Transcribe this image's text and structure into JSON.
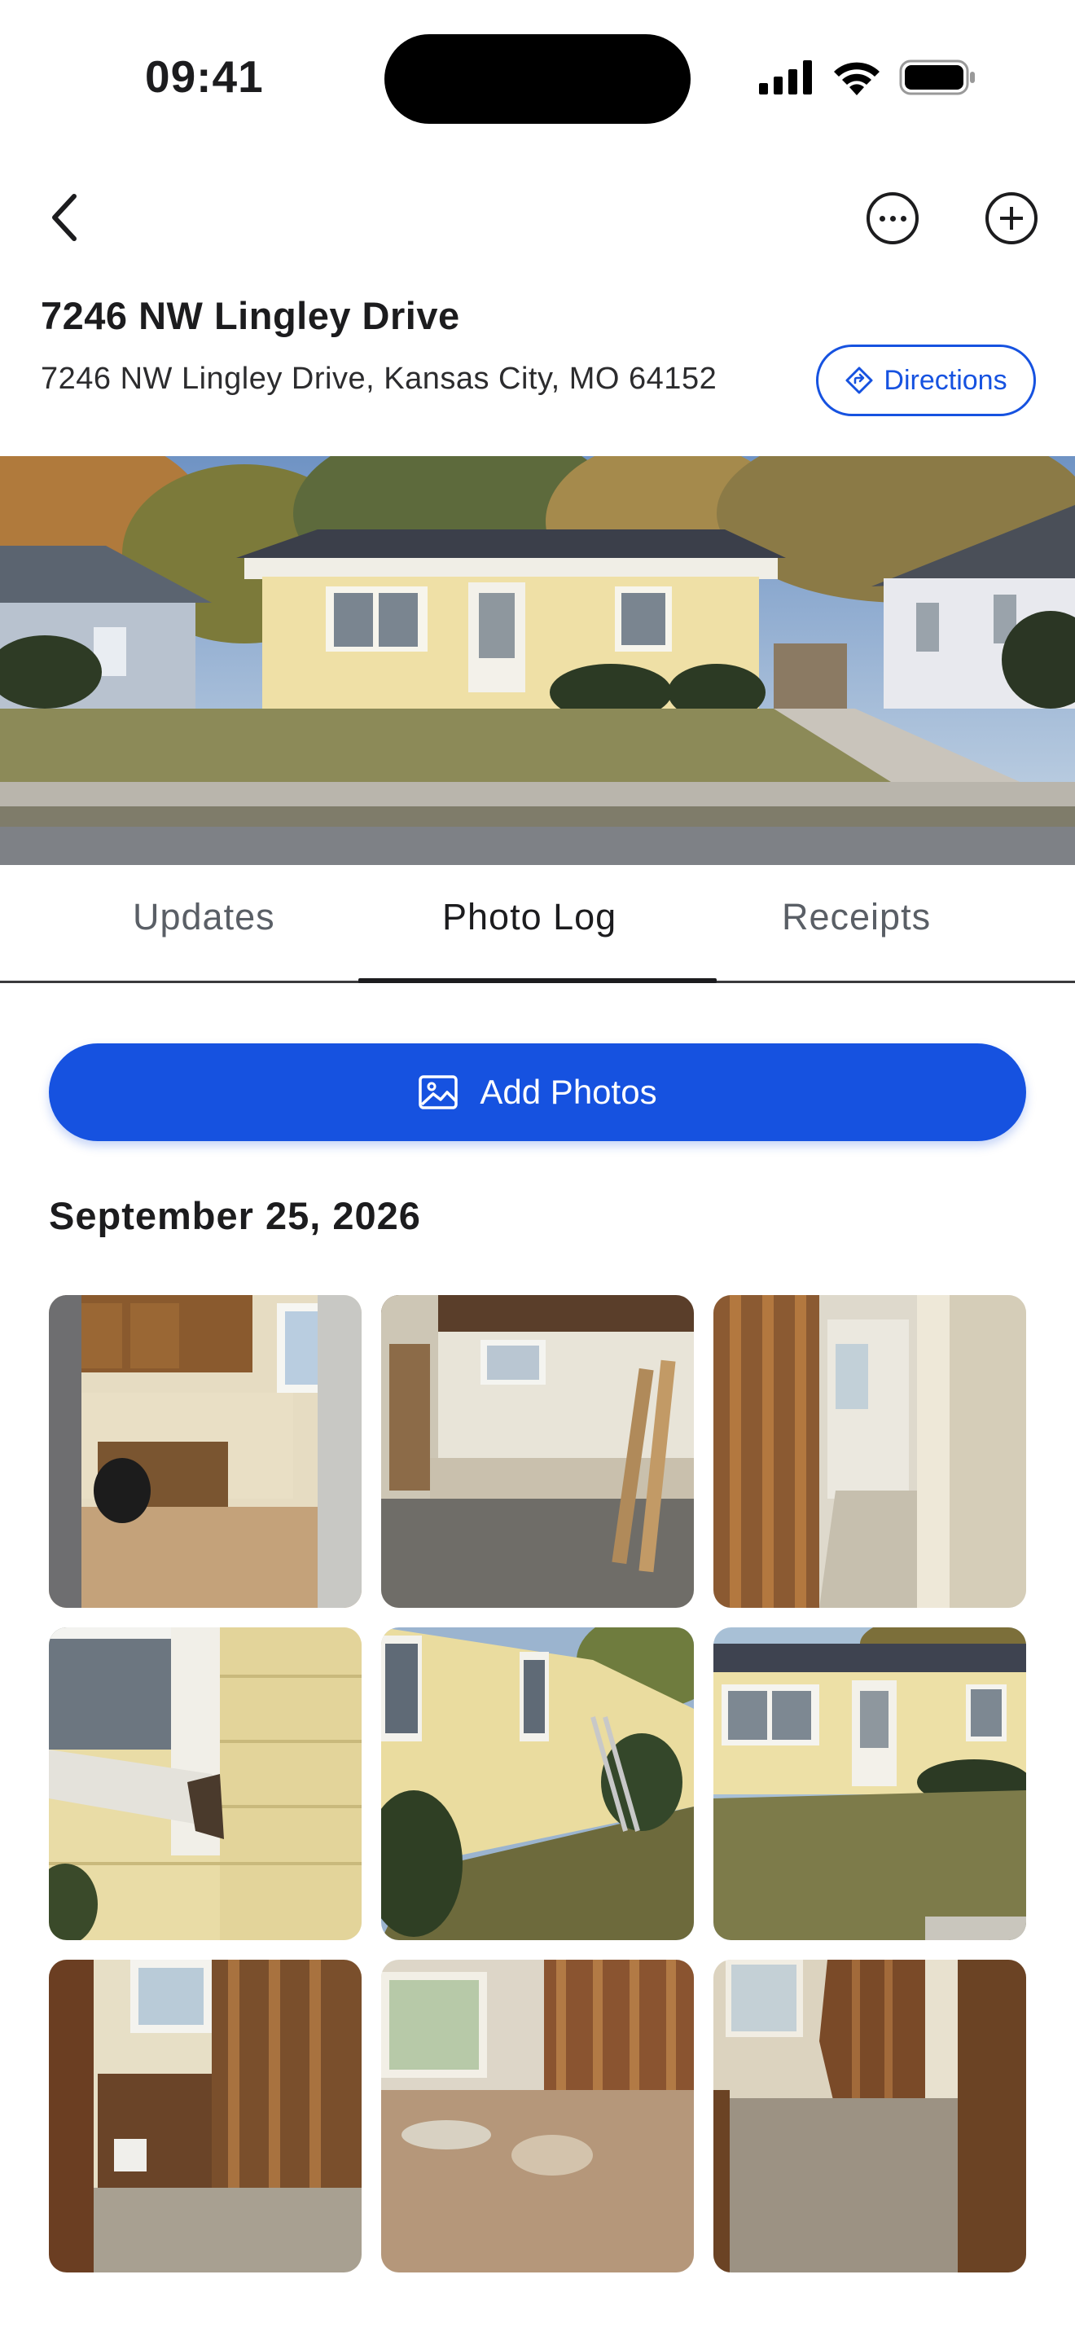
{
  "status_bar": {
    "time": "09:41"
  },
  "nav": {
    "back_icon": "chevron-left-icon",
    "more_icon": "ellipsis-circle-icon",
    "add_icon": "plus-circle-icon"
  },
  "property": {
    "title": "7246 NW Lingley Drive",
    "address": "7246 NW Lingley Drive, Kansas City, MO 64152",
    "directions_label": "Directions"
  },
  "tabs": [
    {
      "label": "Updates",
      "active": false
    },
    {
      "label": "Photo Log",
      "active": true
    },
    {
      "label": "Receipts",
      "active": false
    }
  ],
  "add_photos_label": "Add Photos",
  "photo_log": {
    "date": "September 25, 2026",
    "photos": [
      "kitchen-gutted-photo",
      "basement-photo",
      "hallway-framing-photo",
      "window-trim-rot-photo",
      "siding-side-yard-photo",
      "house-front-photo",
      "bathroom-demo-photo",
      "bedroom-demo-photo",
      "bedroom-closet-demo-photo"
    ]
  },
  "colors": {
    "accent": "#1652e0",
    "text": "#1c1c1e",
    "muted": "#5a5f66"
  }
}
